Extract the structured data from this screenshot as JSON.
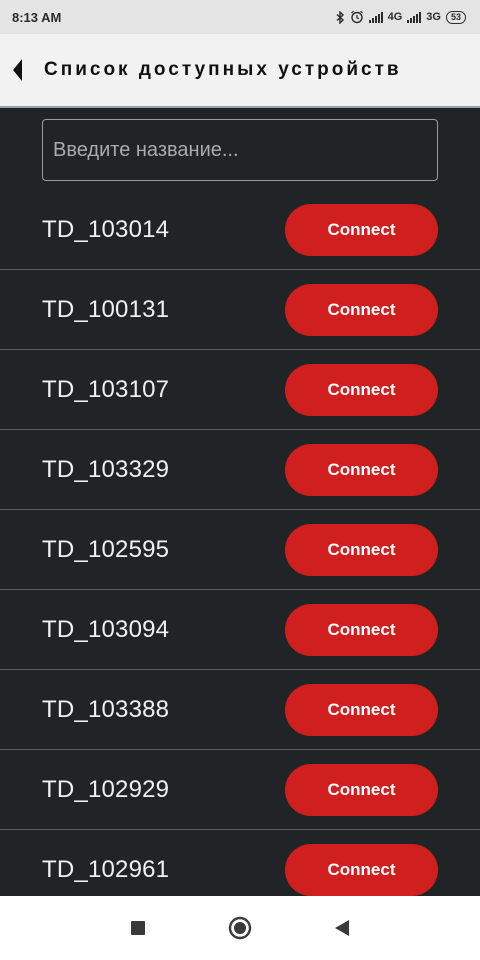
{
  "status_bar": {
    "time": "8:13 AM",
    "icons": [
      "bluetooth-icon",
      "alarm-icon"
    ],
    "network1": "4G",
    "network2": "3G",
    "battery": "53"
  },
  "header": {
    "title": "Список доступных устройств",
    "back_icon": "back-arrow-icon"
  },
  "search": {
    "placeholder": "Введите название...",
    "value": ""
  },
  "devices": [
    {
      "name": "TD_103014",
      "button": "Connect"
    },
    {
      "name": "TD_100131",
      "button": "Connect"
    },
    {
      "name": "TD_103107",
      "button": "Connect"
    },
    {
      "name": "TD_103329",
      "button": "Connect"
    },
    {
      "name": "TD_102595",
      "button": "Connect"
    },
    {
      "name": "TD_103094",
      "button": "Connect"
    },
    {
      "name": "TD_103388",
      "button": "Connect"
    },
    {
      "name": "TD_102929",
      "button": "Connect"
    },
    {
      "name": "TD_102961",
      "button": "Connect"
    }
  ],
  "colors": {
    "background": "#212427",
    "button": "#cf1f1f",
    "header": "#f2f2f2"
  },
  "nav": [
    "recents-square-icon",
    "home-circle-icon",
    "back-triangle-icon"
  ]
}
